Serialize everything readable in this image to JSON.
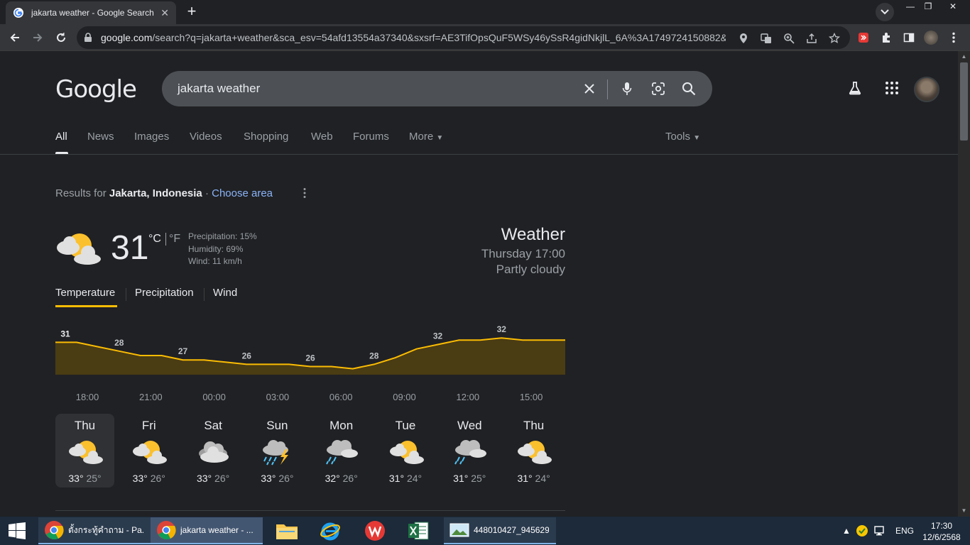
{
  "browser": {
    "tab_title": "jakarta weather - Google Search",
    "url_host": "google.com",
    "url_rest": "/search?q=jakarta+weather&sca_esv=54afd13554a37340&sxsrf=AE3TifOpsQuF5WSy46ySsR4gidNkjlL_6A%3A1749724150882&ei..."
  },
  "google": {
    "logo": "Google",
    "query": "jakarta weather",
    "tabs": [
      "All",
      "News",
      "Images",
      "Videos",
      "Shopping",
      "Web",
      "Forums",
      "More"
    ],
    "tools": "Tools"
  },
  "results_for": {
    "prefix": "Results for",
    "place": "Jakarta, Indonesia",
    "sep": " · ",
    "choose": "Choose area"
  },
  "weather": {
    "current_temp": "31",
    "unit_c": "°C",
    "unit_f": "°F",
    "precipitation": "Precipitation: 15%",
    "humidity": "Humidity: 69%",
    "wind": "Wind: 11 km/h",
    "title": "Weather",
    "datetime": "Thursday 17:00",
    "condition": "Partly cloudy",
    "subtabs": [
      "Temperature",
      "Precipitation",
      "Wind"
    ],
    "accent_color": "#fbbc04",
    "fill_color": "#4a3c13"
  },
  "chart_data": {
    "type": "area",
    "x": [
      "17:00",
      "18:00",
      "19:00",
      "20:00",
      "21:00",
      "22:00",
      "23:00",
      "00:00",
      "01:00",
      "02:00",
      "03:00",
      "04:00",
      "05:00",
      "06:00",
      "07:00",
      "08:00",
      "09:00",
      "10:00",
      "11:00",
      "12:00",
      "13:00",
      "14:00",
      "15:00",
      "16:00",
      "17:00"
    ],
    "values": [
      31,
      31,
      30,
      29,
      28,
      28,
      27,
      27,
      26.5,
      26,
      26,
      26,
      25.5,
      25.5,
      25,
      26,
      27.5,
      29.5,
      30.5,
      31.5,
      31.5,
      32,
      31.5,
      31.5,
      31.5
    ],
    "labels": [
      {
        "i": 0,
        "text": "31"
      },
      {
        "i": 3,
        "text": "28"
      },
      {
        "i": 6,
        "text": "27"
      },
      {
        "i": 9,
        "text": "26"
      },
      {
        "i": 12,
        "text": "26"
      },
      {
        "i": 15,
        "text": "28"
      },
      {
        "i": 18,
        "text": "32"
      },
      {
        "i": 21,
        "text": "32"
      }
    ],
    "tick_labels": [
      "18:00",
      "21:00",
      "00:00",
      "03:00",
      "06:00",
      "09:00",
      "12:00",
      "15:00"
    ]
  },
  "forecast": [
    {
      "day": "Thu",
      "hi": "33°",
      "lo": "25°",
      "icon": "partly-cloudy-icon",
      "selected": true
    },
    {
      "day": "Fri",
      "hi": "33°",
      "lo": "26°",
      "icon": "partly-cloudy-icon"
    },
    {
      "day": "Sat",
      "hi": "33°",
      "lo": "26°",
      "icon": "cloudy-icon"
    },
    {
      "day": "Sun",
      "hi": "33°",
      "lo": "26°",
      "icon": "thunderstorm-icon"
    },
    {
      "day": "Mon",
      "hi": "32°",
      "lo": "26°",
      "icon": "rain-icon"
    },
    {
      "day": "Tue",
      "hi": "31°",
      "lo": "24°",
      "icon": "partly-cloudy-icon"
    },
    {
      "day": "Wed",
      "hi": "31°",
      "lo": "25°",
      "icon": "rain-icon"
    },
    {
      "day": "Thu",
      "hi": "31°",
      "lo": "24°",
      "icon": "partly-cloudy-icon"
    }
  ],
  "taskbar": {
    "item1": "ตั้งกระทู้คำถาม - Pa...",
    "item2": "jakarta weather - ...",
    "item3": "448010427_945629...",
    "lang": "ENG",
    "time": "17:30",
    "date": "12/6/2568"
  }
}
